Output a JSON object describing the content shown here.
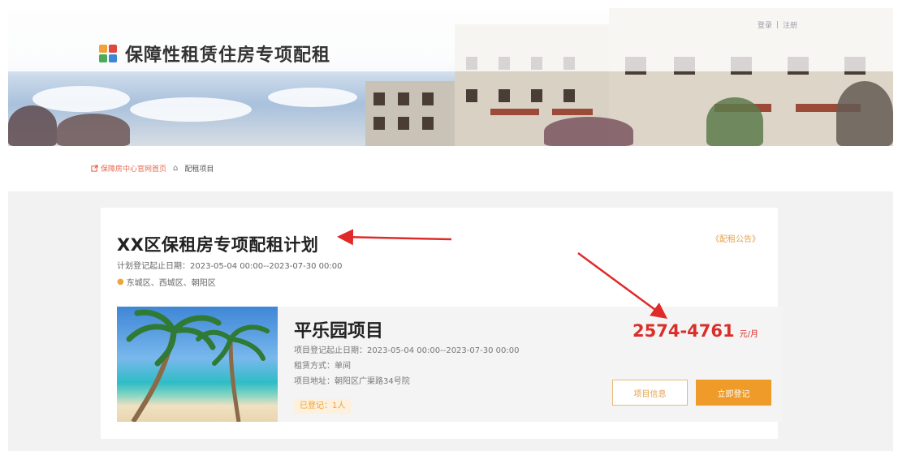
{
  "header": {
    "auth_links": [
      "登录",
      "|",
      "注册"
    ],
    "site_title": "保障性租赁住房专项配租",
    "logo_icon": "four-square-logo-icon"
  },
  "breadcrumb": {
    "home_site_link": "保障房中心官网首页",
    "home_icon": "house-icon",
    "current": "配租项目"
  },
  "plan": {
    "title": "XX区保租房专项配租计划",
    "notice_link": "《配租公告》",
    "dates": "计划登记起止日期：2023-05-04 00:00--2023-07-30 00:00",
    "areas": "东城区、西城区、朝阳区",
    "location_icon": "map-pin-icon"
  },
  "project": {
    "name": "平乐园项目",
    "registration_dates": "项目登记起止日期：2023-05-04 00:00--2023-07-30 00:00",
    "rental_method": "租赁方式：单间",
    "address": "项目地址：朝阳区广渠路34号院",
    "registered": "已登记：1人",
    "price": "2574-4761",
    "price_unit": "元/月",
    "info_button": "项目信息",
    "register_button": "立即登记"
  },
  "colors": {
    "accent_orange": "#ef9b2a",
    "price_red": "#d92f2a",
    "annotation_red": "#e02a2a"
  }
}
